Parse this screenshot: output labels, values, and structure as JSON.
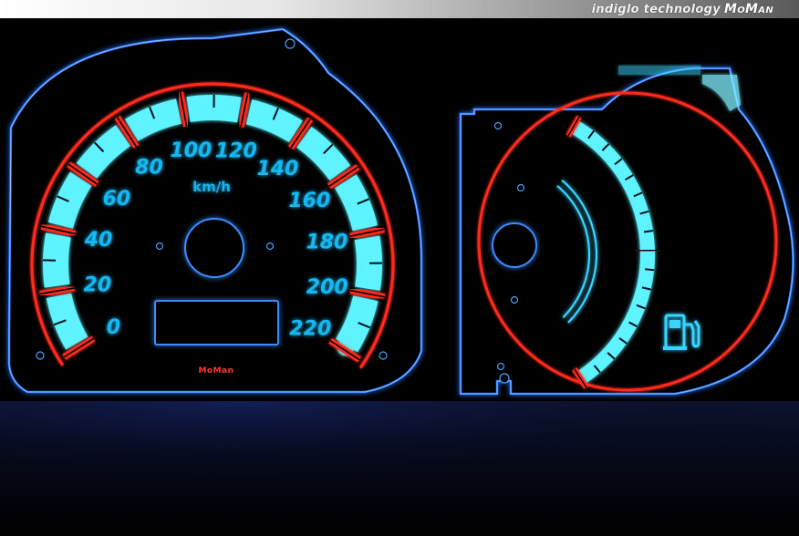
{
  "banner": {
    "text": "indiglo technology",
    "brand": "MoMan"
  },
  "speedometer": {
    "unit": "km/h",
    "brand": "MoMan",
    "labels": [
      "0",
      "20",
      "40",
      "60",
      "80",
      "100",
      "120",
      "140",
      "160",
      "180",
      "200",
      "220"
    ]
  },
  "fuel_gauge": {
    "icon": "fuel-pump-icon"
  },
  "colors": {
    "cyan": "#5ff2ff",
    "label_blue": "#12b8f2",
    "red": "#ff2a1c",
    "panel_edge": "#2a78ff"
  }
}
